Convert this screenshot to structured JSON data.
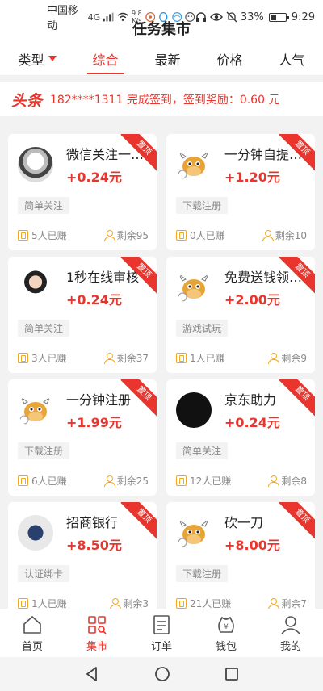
{
  "status_bar": {
    "carrier": "中国移动",
    "network": "4G",
    "speed_value": "9.8",
    "speed_unit": "K/s",
    "battery": "33%",
    "time": "9:29"
  },
  "app_title": "任务集市",
  "tabs": [
    {
      "label": "类型",
      "has_dropdown": true
    },
    {
      "label": "综合",
      "active": true
    },
    {
      "label": "最新"
    },
    {
      "label": "价格"
    },
    {
      "label": "人气"
    }
  ],
  "ticker": {
    "badge": "头条",
    "text": "182****1311 完成签到，签到奖励：0.60 元"
  },
  "pin_label": "置顶",
  "tasks": [
    {
      "title": "微信关注一…",
      "price": "+0.24元",
      "tag": "简单关注",
      "earned": "5人已赚",
      "remaining": "剩余95",
      "avatar": "girl"
    },
    {
      "title": "一分钟自提…",
      "price": "+1.20元",
      "tag": "下载注册",
      "earned": "0人已赚",
      "remaining": "剩余10",
      "avatar": "cow"
    },
    {
      "title": "1秒在线审核",
      "price": "+0.24元",
      "tag": "简单关注",
      "earned": "3人已赚",
      "remaining": "剩余37",
      "avatar": "woman"
    },
    {
      "title": "免费送钱领…",
      "price": "+2.00元",
      "tag": "游戏试玩",
      "earned": "1人已赚",
      "remaining": "剩余9",
      "avatar": "cow"
    },
    {
      "title": "一分钟注册",
      "price": "+1.99元",
      "tag": "下载注册",
      "earned": "6人已赚",
      "remaining": "剩余25",
      "avatar": "cow"
    },
    {
      "title": "京东助力",
      "price": "+0.24元",
      "tag": "简单关注",
      "earned": "12人已赚",
      "remaining": "剩余8",
      "avatar": "black"
    },
    {
      "title": "招商银行",
      "price": "+8.50元",
      "tag": "认证绑卡",
      "earned": "1人已赚",
      "remaining": "剩余3",
      "avatar": "bottle"
    },
    {
      "title": "砍一刀",
      "price": "+8.00元",
      "tag": "下载注册",
      "earned": "21人已赚",
      "remaining": "剩余7",
      "avatar": "cow"
    }
  ],
  "bottom_nav": [
    {
      "label": "首页",
      "icon": "home-icon"
    },
    {
      "label": "集市",
      "icon": "market-icon",
      "active": true
    },
    {
      "label": "订单",
      "icon": "order-icon"
    },
    {
      "label": "钱包",
      "icon": "wallet-icon"
    },
    {
      "label": "我的",
      "icon": "profile-icon"
    }
  ],
  "colors": {
    "accent": "#e9352d",
    "earn_icon": "#f2a81d"
  }
}
